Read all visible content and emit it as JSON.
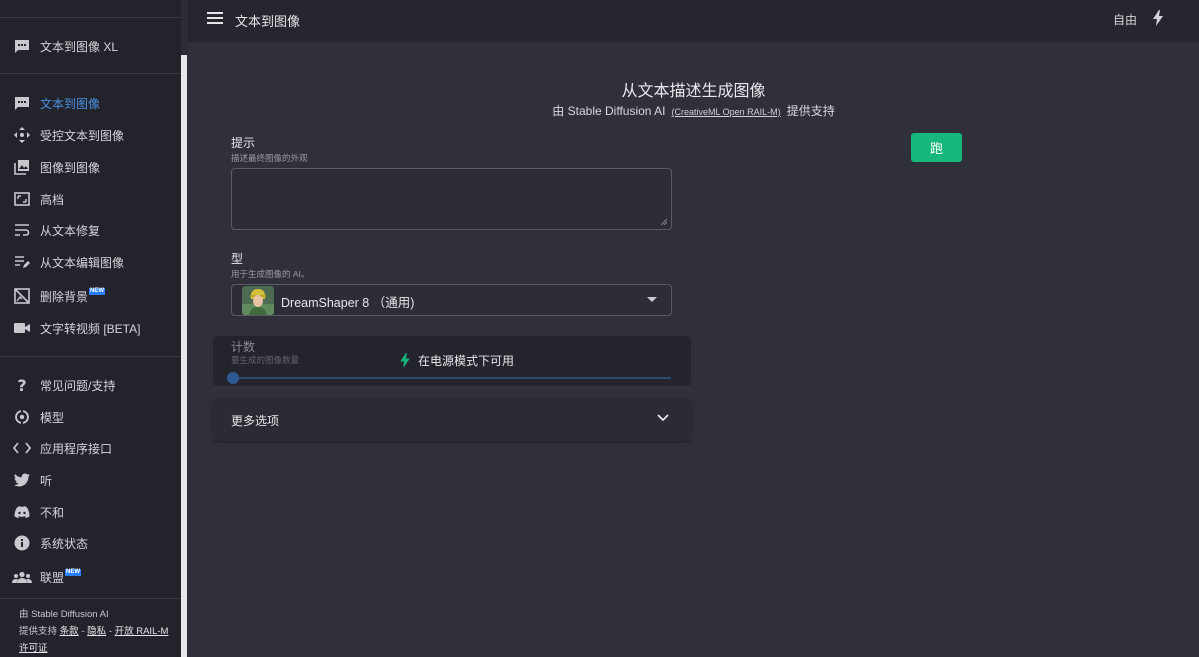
{
  "header": {
    "title": "文本到图像",
    "plan": "自由"
  },
  "sidebar": {
    "top_item": "文本到图像 XL",
    "items": [
      {
        "label": "文本到图像",
        "icon": "chat-bubble-icon",
        "active": true
      },
      {
        "label": "受控文本到图像",
        "icon": "move-arrows-icon"
      },
      {
        "label": "图像到图像",
        "icon": "image-stack-icon"
      },
      {
        "label": "高档",
        "icon": "upscale-icon"
      },
      {
        "label": "从文本修复",
        "icon": "wrap-text-icon"
      },
      {
        "label": "从文本编辑图像",
        "icon": "edit-lines-icon"
      },
      {
        "label": "删除背景",
        "icon": "hide-image-icon",
        "badge": "NEW"
      },
      {
        "label": "文字转视频 [BETA]",
        "icon": "video-camera-icon"
      }
    ],
    "links": [
      {
        "label": "常见问题/支持",
        "icon": "question-icon"
      },
      {
        "label": "模型",
        "icon": "model-icon"
      },
      {
        "label": "应用程序接口",
        "icon": "code-icon"
      },
      {
        "label": "听",
        "icon": "twitter-icon"
      },
      {
        "label": "不和",
        "icon": "discord-icon"
      },
      {
        "label": "系统状态",
        "icon": "info-icon"
      },
      {
        "label": "联盟",
        "icon": "group-icon",
        "badge": "NEW"
      }
    ],
    "footer": {
      "line1": "由 Stable Diffusion AI",
      "prefix": "提供支持",
      "terms": "条款",
      "sep": "-",
      "privacy": "隐私",
      "license": "开放 RAIL-M 许可证"
    }
  },
  "main": {
    "title": "从文本描述生成图像",
    "subtitle_pre": "由 Stable Diffusion AI",
    "subtitle_license": "(CreativeML Open RAIL-M)",
    "subtitle_post": "提供支持",
    "prompt": {
      "label": "提示",
      "hint": "描述最终图像的外观",
      "value": ""
    },
    "run_button": "跑",
    "model": {
      "label": "型",
      "hint": "用于生成图像的 AI。",
      "selected": "DreamShaper 8 （通用)"
    },
    "count": {
      "label": "计数",
      "hint": "要生成的图像数量",
      "power_note": "在电源模式下可用",
      "value": 1
    },
    "more_options": "更多选项"
  },
  "colors": {
    "accent": "#4a90e2",
    "run": "#17b87c",
    "power": "#17b87c",
    "badge": "#2a7fff"
  }
}
